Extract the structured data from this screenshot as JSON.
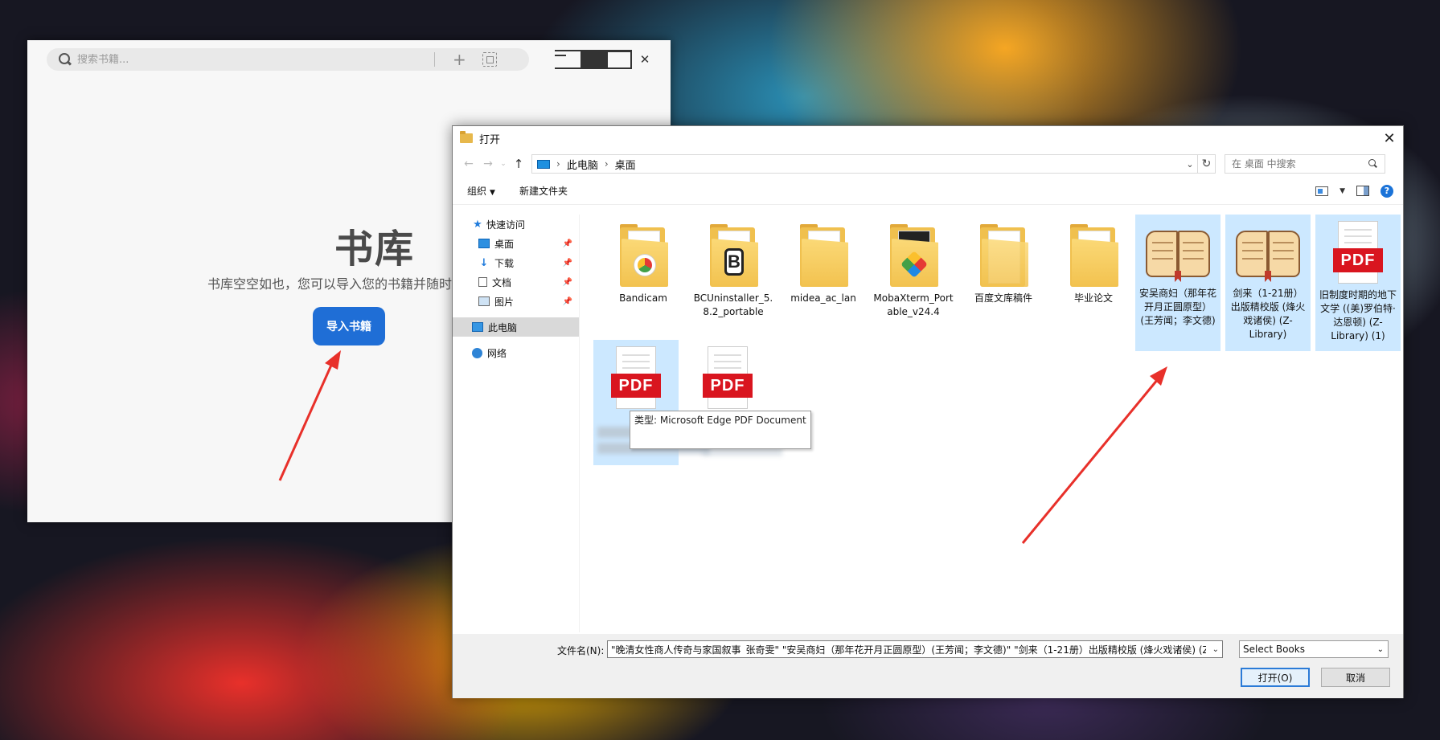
{
  "app": {
    "search_placeholder": "搜索书籍...",
    "title": "书库",
    "subtitle": "书库空空如也，您可以导入您的书籍并随时",
    "import_button": "导入书籍"
  },
  "dialog": {
    "title": "打开",
    "breadcrumb": [
      "此电脑",
      "桌面"
    ],
    "search_placeholder": "在 桌面 中搜索",
    "toolbar": {
      "organize": "组织",
      "new_folder": "新建文件夹"
    },
    "nav": [
      {
        "label": "快速访问",
        "icon": "star-icon"
      },
      {
        "label": "桌面",
        "icon": "desktop-icon",
        "pinned": true
      },
      {
        "label": "下载",
        "icon": "download-icon",
        "pinned": true
      },
      {
        "label": "文档",
        "icon": "document-icon",
        "pinned": true
      },
      {
        "label": "图片",
        "icon": "picture-icon",
        "pinned": true
      },
      {
        "label": "此电脑",
        "icon": "computer-icon",
        "selected": true
      },
      {
        "label": "网络",
        "icon": "network-icon"
      }
    ],
    "files": [
      {
        "name": "Bandicam",
        "type": "folder"
      },
      {
        "name": "BCUninstaller_5.8.2_portable",
        "type": "folder"
      },
      {
        "name": "midea_ac_lan",
        "type": "folder"
      },
      {
        "name": "MobaXterm_Portable_v24.4",
        "type": "folder"
      },
      {
        "name": "百度文库稿件",
        "type": "folder"
      },
      {
        "name": "毕业论文",
        "type": "folder"
      },
      {
        "name": "安吴商妇（那年花开月正圆原型）(王芳闻；李文德)",
        "type": "book",
        "selected": true
      },
      {
        "name": "剑来（1-21册）出版精校版 (烽火戏诸侯) (Z-Library)",
        "type": "book",
        "selected": true
      },
      {
        "name": "旧制度时期的地下文学 ((美)罗伯特·达恩顿) (Z-Library) (1)",
        "type": "pdf",
        "selected": true
      },
      {
        "name": "",
        "type": "pdf",
        "selected": true
      },
      {
        "name": "",
        "type": "pdf"
      }
    ],
    "pdf_label": "PDF",
    "tooltip": "类型: Microsoft Edge PDF Document",
    "filename_label": "文件名(N):",
    "filename_value": "\"晚清女性商人传奇与家国叙事_张奇雯\" \"安吴商妇（那年花开月正圆原型）(王芳闻；李文德)\" \"剑来（1-21册）出版精校版 (烽火戏诸侯) (Z-L",
    "filter": "Select Books",
    "open_button": "打开(O)",
    "cancel_button": "取消"
  },
  "colors": {
    "accent": "#1f6ed6",
    "selection": "#cce8ff",
    "arrow": "#e8302a",
    "pdf_red": "#d9151f"
  }
}
